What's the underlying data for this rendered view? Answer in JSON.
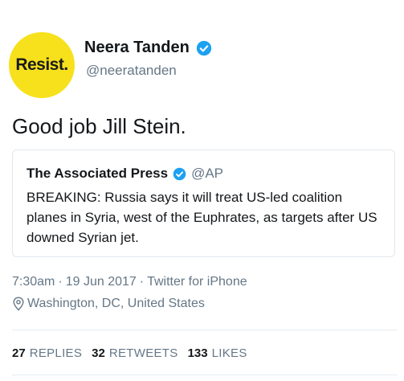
{
  "author": {
    "display_name": "Neera Tanden",
    "handle": "@neeratanden",
    "avatar_text": "Resist.",
    "avatar_color": "#f6e11c",
    "verified_icon": "verified-badge"
  },
  "tweet": {
    "text": "Good job Jill Stein."
  },
  "quoted_tweet": {
    "author_name": "The Associated Press",
    "author_handle": "@AP",
    "text": "BREAKING: Russia says it will treat US-led coalition planes in Syria, west of the Euphrates, as targets after US downed Syrian jet."
  },
  "meta": {
    "time": "7:30am",
    "separator": "·",
    "date": "19 Jun 2017",
    "source": "Twitter for iPhone",
    "location": "Washington, DC, United States"
  },
  "stats": {
    "replies_count": "27",
    "replies_label": "REPLIES",
    "retweets_count": "32",
    "retweets_label": "RETWEETS",
    "likes_count": "133",
    "likes_label": "LIKES"
  },
  "colors": {
    "verified_blue": "#1da1f2",
    "secondary_text": "#657786",
    "primary_text": "#14171a"
  }
}
